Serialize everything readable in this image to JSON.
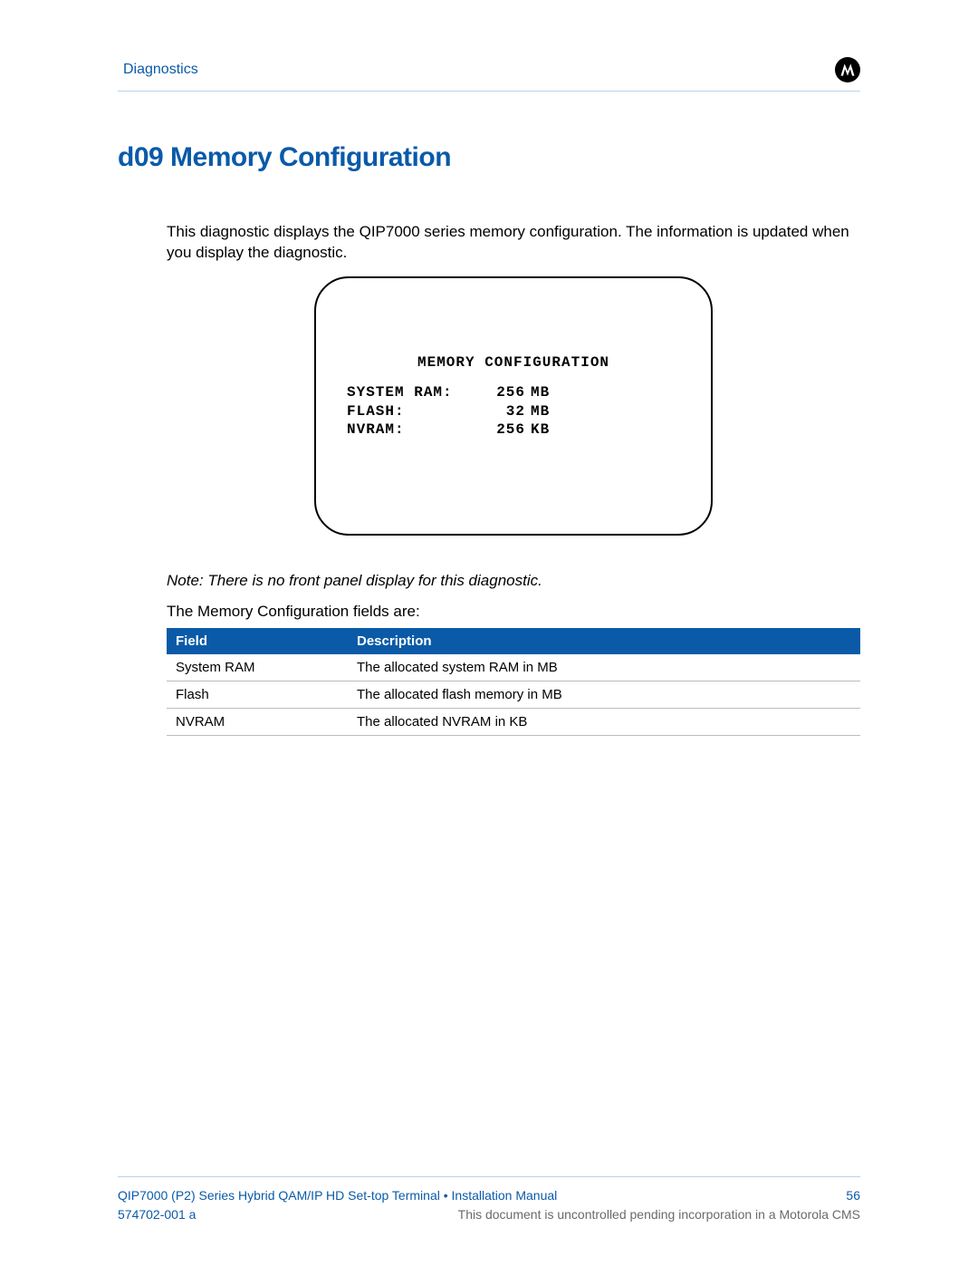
{
  "header": {
    "breadcrumb": "Diagnostics",
    "logo_name": "motorola-logo"
  },
  "section": {
    "title": "d09 Memory Configuration",
    "intro": "This diagnostic displays the QIP7000 series memory configuration. The information is updated when you display the diagnostic."
  },
  "screen": {
    "title": "MEMORY CONFIGURATION",
    "rows": [
      {
        "label": "SYSTEM RAM:",
        "value": "256",
        "unit": "MB"
      },
      {
        "label": "FLASH:",
        "value": "32",
        "unit": "MB"
      },
      {
        "label": "NVRAM:",
        "value": "256",
        "unit": "KB"
      }
    ]
  },
  "note": "Note: There is no front panel display for this diagnostic.",
  "fields_intro": "The Memory Configuration fields are:",
  "fields_table": {
    "headers": {
      "field": "Field",
      "desc": "Description"
    },
    "rows": [
      {
        "field": "System RAM",
        "desc": "The allocated system RAM in MB"
      },
      {
        "field": "Flash",
        "desc": "The allocated flash memory in MB"
      },
      {
        "field": "NVRAM",
        "desc": "The allocated NVRAM in KB"
      }
    ]
  },
  "footer": {
    "line1_left": "QIP7000 (P2) Series Hybrid QAM/IP HD Set-top Terminal • Installation Manual",
    "page_number": "56",
    "doc_id": "574702-001 a",
    "line2_right": "This document is uncontrolled pending incorporation in a Motorola CMS"
  }
}
